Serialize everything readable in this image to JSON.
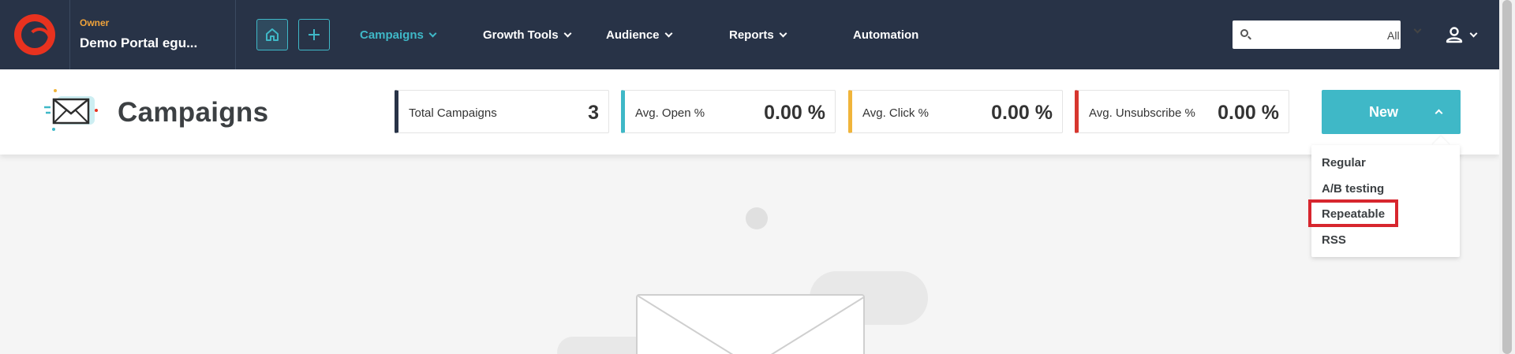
{
  "colors": {
    "nav_bg": "#283347",
    "accent": "#3fb8c7",
    "brand_red": "#e8321f",
    "owner_orange": "#f0a33a",
    "highlight": "#d7262e"
  },
  "topnav": {
    "logo_icon": "sendinblue-logo",
    "owner_label": "Owner",
    "portal_name": "Demo Portal egu...",
    "home_icon": "home-icon",
    "add_icon": "plus-icon",
    "items": [
      {
        "label": "Campaigns",
        "active": true,
        "has_dropdown": true
      },
      {
        "label": "Growth Tools",
        "active": false,
        "has_dropdown": true
      },
      {
        "label": "Audience",
        "active": false,
        "has_dropdown": true
      },
      {
        "label": "Reports",
        "active": false,
        "has_dropdown": true
      },
      {
        "label": "Automation",
        "active": false,
        "has_dropdown": false
      }
    ],
    "search": {
      "value": "",
      "placeholder": "",
      "scope": "All"
    },
    "user_icon": "user-icon"
  },
  "header": {
    "title": "Campaigns",
    "icon": "envelope-icon",
    "stats": [
      {
        "label": "Total Campaigns",
        "value": "3",
        "color": "#283347"
      },
      {
        "label": "Avg. Open %",
        "value": "0.00 %",
        "color": "#3fb8c7"
      },
      {
        "label": "Avg. Click %",
        "value": "0.00 %",
        "color": "#f0b43a"
      },
      {
        "label": "Avg. Unsubscribe %",
        "value": "0.00 %",
        "color": "#d7362e"
      }
    ],
    "new_button": {
      "label": "New",
      "expanded": true
    }
  },
  "new_menu": {
    "items": [
      {
        "label": "Regular"
      },
      {
        "label": "A/B testing"
      },
      {
        "label": "Repeatable",
        "highlighted": true
      },
      {
        "label": "RSS"
      }
    ]
  }
}
